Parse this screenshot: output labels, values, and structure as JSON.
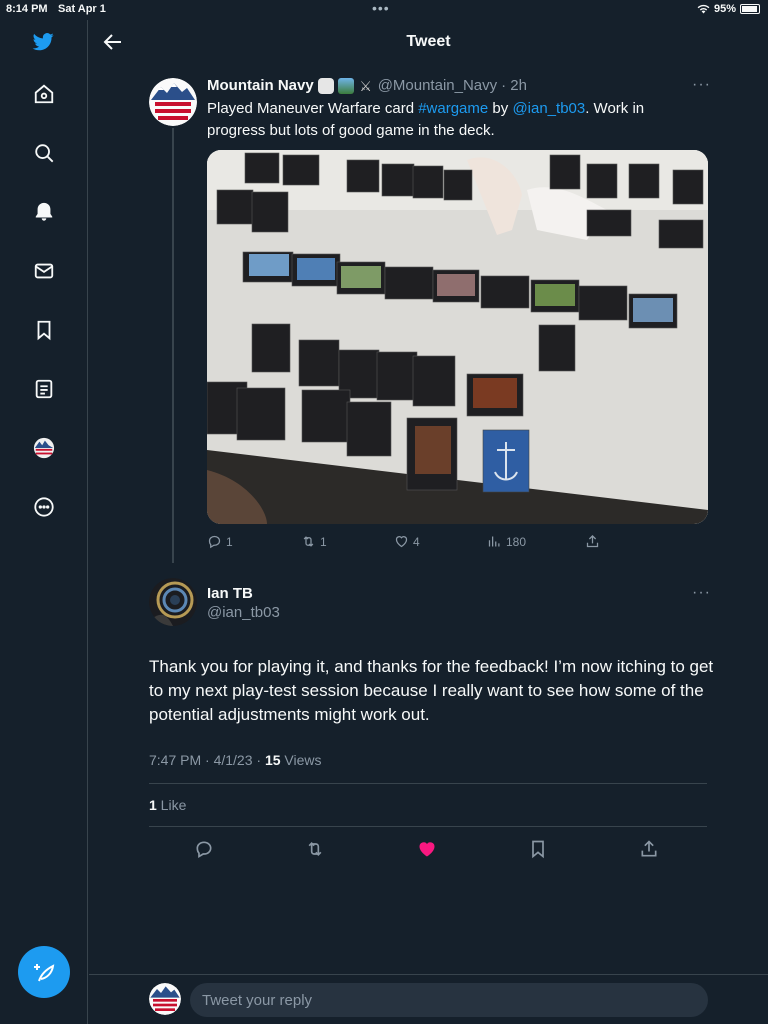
{
  "status_bar": {
    "time": "8:14 PM",
    "date": "Sat Apr 1",
    "battery": "95%"
  },
  "header": {
    "title": "Tweet"
  },
  "sidebar": {
    "items": [
      "home-icon",
      "search-icon",
      "notifications-icon",
      "messages-icon",
      "bookmarks-icon",
      "lists-icon",
      "profile-avatar",
      "more-icon"
    ]
  },
  "tweet1": {
    "name": "Mountain Navy",
    "handle": "@Mountain_Navy",
    "time": "· 2h",
    "text_before": "Played Maneuver Warfare card ",
    "hashtag": "#wargame",
    "text_by": " by ",
    "mention": "@ian_tb03",
    "text_after": ". Work in progress but lots of good game in the deck.",
    "stats": {
      "replies": "1",
      "retweets": "1",
      "likes": "4",
      "views": "180"
    }
  },
  "tweet2": {
    "name": "Ian TB",
    "handle": "@ian_tb03",
    "text": "Thank you for playing it, and thanks for the feedback! I’m now itching to get to my next play-test session because I really want to see how some of the potential adjustments might work out.",
    "date": "7:47 PM · 4/1/23 · ",
    "views_count": "15",
    "views_label": " Views",
    "likes_count": "1",
    "likes_label": " Like"
  },
  "reply": {
    "placeholder": "Tweet your reply"
  },
  "colors": {
    "background": "#15202b",
    "accent": "#1d9bf0",
    "like": "#f91880",
    "muted": "#8b98a5"
  }
}
